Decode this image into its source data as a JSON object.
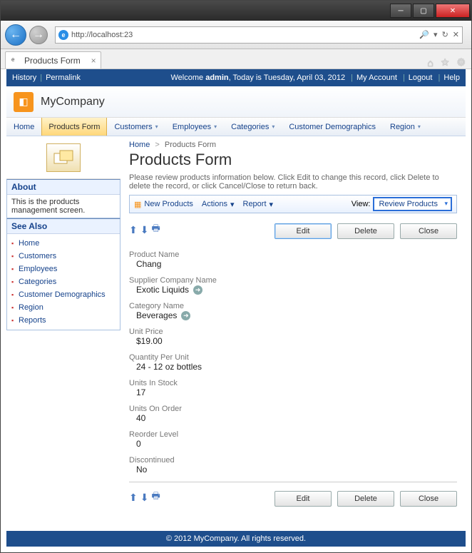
{
  "browser": {
    "url": "http://localhost:23",
    "url_tools": "♀ ▾  ✕",
    "search_icons": [
      "♀",
      "▾",
      "🔄",
      "✕"
    ],
    "tab_title": "Products Form",
    "ie_tools": [
      "⌂",
      "★",
      "⚙"
    ]
  },
  "appbar": {
    "history": "History",
    "permalink": "Permalink",
    "welcome_prefix": "Welcome ",
    "welcome_user": "admin",
    "welcome_date": ", Today is Tuesday, April 03, 2012",
    "myaccount": "My Account",
    "logout": "Logout",
    "help": "Help"
  },
  "company": {
    "name": "MyCompany"
  },
  "menu": {
    "items": [
      "Home",
      "Products Form",
      "Customers",
      "Employees",
      "Categories",
      "Customer Demographics",
      "Region"
    ],
    "active_index": 1,
    "has_caret": [
      false,
      false,
      true,
      true,
      true,
      false,
      true
    ]
  },
  "sidebar": {
    "about_title": "About",
    "about_text": "This is the products management screen.",
    "seealso_title": "See Also",
    "seealso": [
      "Home",
      "Customers",
      "Employees",
      "Categories",
      "Customer Demographics",
      "Region",
      "Reports"
    ]
  },
  "page": {
    "breadcrumb_home": "Home",
    "breadcrumb_sep": ">",
    "breadcrumb_current": "Products Form",
    "title": "Products Form",
    "help": "Please review products information below. Click Edit to change this record, click Delete to delete the record, or click Cancel/Close to return back."
  },
  "toolbar": {
    "new": "New Products",
    "actions": "Actions",
    "report": "Report",
    "view_label": "View:",
    "view_value": "Review Products"
  },
  "buttons": {
    "edit": "Edit",
    "delete": "Delete",
    "close": "Close"
  },
  "record": {
    "fields": [
      {
        "label": "Product Name",
        "value": "Chang",
        "link": false
      },
      {
        "label": "Supplier Company Name",
        "value": "Exotic Liquids",
        "link": true
      },
      {
        "label": "Category Name",
        "value": "Beverages",
        "link": true
      },
      {
        "label": "Unit Price",
        "value": "$19.00",
        "link": false
      },
      {
        "label": "Quantity Per Unit",
        "value": "24 - 12 oz bottles",
        "link": false
      },
      {
        "label": "Units In Stock",
        "value": "17",
        "link": false
      },
      {
        "label": "Units On Order",
        "value": "40",
        "link": false
      },
      {
        "label": "Reorder Level",
        "value": "0",
        "link": false
      },
      {
        "label": "Discontinued",
        "value": "No",
        "link": false
      }
    ]
  },
  "footer": {
    "text": "© 2012 MyCompany. All rights reserved."
  }
}
